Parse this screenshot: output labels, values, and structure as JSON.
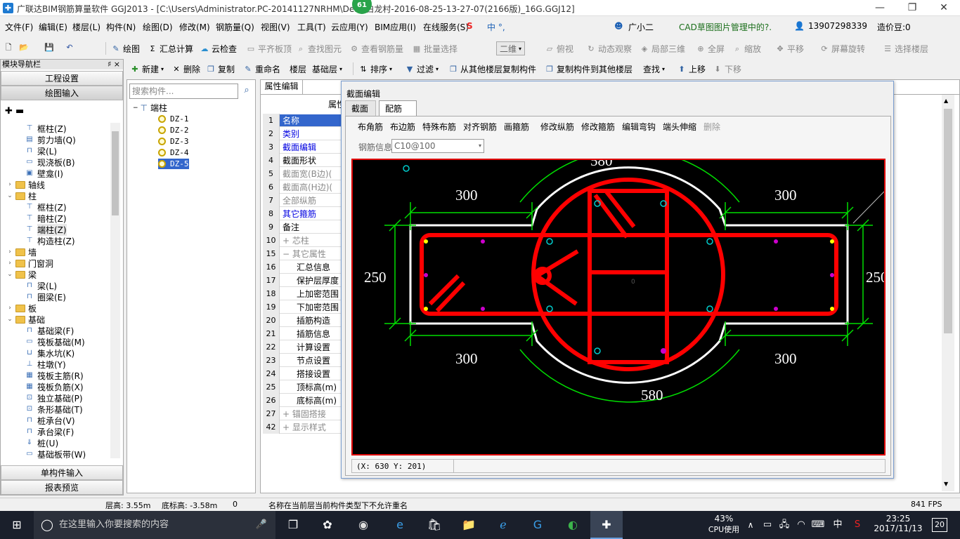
{
  "window": {
    "title": "广联达BIM钢筋算量软件 GGJ2013 - [C:\\Users\\Administrator.PC-20141127NRHM\\De...(白龙村-2016-08-25-13-27-07(2166版)_16G.GGJ12]",
    "badge": "61",
    "min": "—",
    "restore": "❐",
    "close": "✕"
  },
  "menu": [
    "文件(F)",
    "编辑(E)",
    "楼层(L)",
    "构件(N)",
    "绘图(D)",
    "修改(M)",
    "钢筋量(Q)",
    "视图(V)",
    "工具(T)",
    "云应用(Y)",
    "BIM应用(I)",
    "在线服务(S)"
  ],
  "menu_right": {
    "ime": "中 °, ",
    "assistant": "广小二",
    "cad_tip": "CAD草图图片管理中的?.",
    "phone": "13907298339",
    "price": "造价豆:0"
  },
  "toolbar1": {
    "draw": "绘图",
    "sum": "汇总计算",
    "cloud_check": "云检查",
    "flat_top": "平齐板顶",
    "find_elem": "查找图元",
    "view_steel": "查看钢筋量",
    "batch_select": "批量选择",
    "view2d": "二维",
    "top_view": "俯视",
    "dynamic": "动态观察",
    "local3d": "局部三维",
    "fullscreen": "全屏",
    "zoom": "缩放",
    "pan": "平移",
    "rotate": "屏幕旋转",
    "select_floor": "选择楼层"
  },
  "toolbar2": {
    "new": "新建",
    "delete": "删除",
    "copy": "复制",
    "rename": "重命名",
    "floor_label": "楼层",
    "floor_value": "基础层",
    "sort": "排序",
    "filter": "过滤",
    "copy_from": "从其他楼层复制构件",
    "copy_to": "复制构件到其他楼层",
    "find": "查找",
    "up": "上移",
    "down": "下移"
  },
  "nav": {
    "header": "模块导航栏",
    "pin": "♯ ×",
    "project_settings": "工程设置",
    "draw_input": "绘图输入",
    "single_input": "单构件输入",
    "report_preview": "报表预览",
    "tree": [
      {
        "label": "框柱(Z)",
        "level": 2,
        "icon": "column"
      },
      {
        "label": "剪力墙(Q)",
        "level": 2,
        "icon": "wall"
      },
      {
        "label": "梁(L)",
        "level": 2,
        "icon": "beam"
      },
      {
        "label": "现浇板(B)",
        "level": 2,
        "icon": "slab"
      },
      {
        "label": "壁龛(I)",
        "level": 2,
        "icon": "niche"
      },
      {
        "label": "轴线",
        "level": 1,
        "icon": "folder",
        "exp": "+"
      },
      {
        "label": "柱",
        "level": 1,
        "icon": "folder",
        "exp": "−"
      },
      {
        "label": "框柱(Z)",
        "level": 2,
        "icon": "column"
      },
      {
        "label": "暗柱(Z)",
        "level": 2,
        "icon": "column"
      },
      {
        "label": "端柱(Z)",
        "level": 2,
        "icon": "column"
      },
      {
        "label": "构造柱(Z)",
        "level": 2,
        "icon": "column"
      },
      {
        "label": "墙",
        "level": 1,
        "icon": "folder",
        "exp": "+"
      },
      {
        "label": "门窗洞",
        "level": 1,
        "icon": "folder",
        "exp": "+"
      },
      {
        "label": "梁",
        "level": 1,
        "icon": "folder",
        "exp": "−"
      },
      {
        "label": "梁(L)",
        "level": 2,
        "icon": "beam"
      },
      {
        "label": "圈梁(E)",
        "level": 2,
        "icon": "beam"
      },
      {
        "label": "板",
        "level": 1,
        "icon": "folder",
        "exp": "+"
      },
      {
        "label": "基础",
        "level": 1,
        "icon": "folder",
        "exp": "−"
      },
      {
        "label": "基础梁(F)",
        "level": 2,
        "icon": "beam"
      },
      {
        "label": "筏板基础(M)",
        "level": 2,
        "icon": "slab"
      },
      {
        "label": "集水坑(K)",
        "level": 2,
        "icon": "pit"
      },
      {
        "label": "柱墩(Y)",
        "level": 2,
        "icon": "pier"
      },
      {
        "label": "筏板主筋(R)",
        "level": 2,
        "icon": "grid"
      },
      {
        "label": "筏板负筋(X)",
        "level": 2,
        "icon": "grid"
      },
      {
        "label": "独立基础(P)",
        "level": 2,
        "icon": "found"
      },
      {
        "label": "条形基础(T)",
        "level": 2,
        "icon": "found"
      },
      {
        "label": "桩承台(V)",
        "level": 2,
        "icon": "cap"
      },
      {
        "label": "承台梁(F)",
        "level": 2,
        "icon": "beam"
      },
      {
        "label": "桩(U)",
        "level": 2,
        "icon": "pile"
      },
      {
        "label": "基础板带(W)",
        "level": 2,
        "icon": "slab"
      }
    ]
  },
  "components": {
    "search_placeholder": "搜索构件...",
    "root": "端柱",
    "items": [
      "DZ-1",
      "DZ-2",
      "DZ-3",
      "DZ-4",
      "DZ-5"
    ],
    "selected": "DZ-5"
  },
  "properties": {
    "tab": "属性编辑",
    "header": "属性",
    "rows": [
      {
        "n": "1",
        "label": "名称",
        "style": "blue",
        "sel": true
      },
      {
        "n": "2",
        "label": "类别",
        "style": "blue"
      },
      {
        "n": "3",
        "label": "截面编辑",
        "style": "blue"
      },
      {
        "n": "4",
        "label": "截面形状",
        "style": ""
      },
      {
        "n": "5",
        "label": "截面宽(B边)(",
        "style": "gray"
      },
      {
        "n": "6",
        "label": "截面高(H边)(",
        "style": "gray"
      },
      {
        "n": "7",
        "label": "全部纵筋",
        "style": "gray"
      },
      {
        "n": "8",
        "label": "其它箍筋",
        "style": "blue"
      },
      {
        "n": "9",
        "label": "备注",
        "style": ""
      },
      {
        "n": "10",
        "label": "+ 芯柱",
        "style": "gray"
      },
      {
        "n": "15",
        "label": "− 其它属性",
        "style": "gray"
      },
      {
        "n": "16",
        "label": "汇总信息",
        "style": "ind"
      },
      {
        "n": "17",
        "label": "保护层厚度",
        "style": "ind"
      },
      {
        "n": "18",
        "label": "上加密范围",
        "style": "ind"
      },
      {
        "n": "19",
        "label": "下加密范围",
        "style": "ind"
      },
      {
        "n": "20",
        "label": "插筋构造",
        "style": "ind"
      },
      {
        "n": "21",
        "label": "插筋信息",
        "style": "ind"
      },
      {
        "n": "22",
        "label": "计算设置",
        "style": "ind"
      },
      {
        "n": "23",
        "label": "节点设置",
        "style": "ind"
      },
      {
        "n": "24",
        "label": "搭接设置",
        "style": "ind"
      },
      {
        "n": "25",
        "label": "顶标高(m)",
        "style": "ind"
      },
      {
        "n": "26",
        "label": "底标高(m)",
        "style": "ind"
      },
      {
        "n": "27",
        "label": "+ 锚固搭接",
        "style": "gray"
      },
      {
        "n": "42",
        "label": "+ 显示样式",
        "style": "gray"
      }
    ]
  },
  "dialog": {
    "title": "截面编辑",
    "tabs": [
      "截面",
      "配筋"
    ],
    "active_tab": "配筋",
    "tools": [
      "布角筋",
      "布边筋",
      "特殊布筋",
      "对齐钢筋",
      "画箍筋",
      "修改纵筋",
      "修改箍筋",
      "编辑弯钩",
      "端头伸缩",
      "删除"
    ],
    "rebar_info_label": "钢筋信息",
    "rebar_info_value": "C10@100",
    "coords": "(X: 630 Y: 201)",
    "dims": {
      "top_left": "300",
      "top_right": "300",
      "bottom_left": "300",
      "bottom_right": "300",
      "left_height": "250",
      "right_height": "250",
      "circle_top": "580",
      "circle_bottom": "580",
      "origin": "0"
    }
  },
  "status": {
    "floor_height": "层高: 3.55m",
    "bottom_elev": "底标高: -3.58m",
    "value": "0",
    "message": "名称在当前层当前构件类型下不允许重名",
    "fps": "841 FPS"
  },
  "taskbar": {
    "search_placeholder": "在这里输入你要搜索的内容",
    "cpu_percent": "43%",
    "cpu_label": "CPU使用",
    "ime": "中",
    "time": "23:25",
    "date": "2017/11/13",
    "notifications": "20"
  },
  "colors": {
    "rebar": "#ff0000",
    "dimension": "#00dd00",
    "outline": "#ffffff",
    "canvas_bg": "#000000",
    "selection": "#3366cc"
  }
}
